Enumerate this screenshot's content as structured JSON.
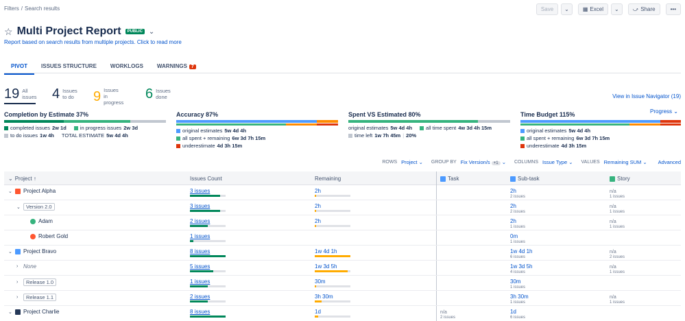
{
  "breadcrumbs": [
    "Filters",
    "Search results"
  ],
  "actions": {
    "save": "Save",
    "excel": "Excel",
    "share": "Share",
    "more": "•••"
  },
  "title": "Multi Project Report",
  "badge": "PUBLIC",
  "subtitle": "Report based on search results from multiple projects. Click to read more",
  "tabs": [
    {
      "label": "PIVOT"
    },
    {
      "label": "ISSUES STRUCTURE"
    },
    {
      "label": "WORKLOGS"
    },
    {
      "label": "WARNINGS",
      "badge": "7"
    }
  ],
  "counters": [
    {
      "num": "19",
      "l1": "All",
      "l2": "issues",
      "color": "#172b4d"
    },
    {
      "num": "4",
      "l1": "Issues",
      "l2": "to do",
      "color": "#172b4d"
    },
    {
      "num": "9",
      "l1": "Issues",
      "l2": "in progress",
      "color": "#ffab00"
    },
    {
      "num": "6",
      "l1": "Issues",
      "l2": "done",
      "color": "#00875a"
    }
  ],
  "view_link": "View in Issue Navigator (19)",
  "progress_dropdown": "Progress",
  "metrics": {
    "completion": {
      "title": "Completion by Estimate",
      "pct": "37%",
      "r1a_label": "completed issues",
      "r1a_val": "2w 1d",
      "r1b_label": "in progress issues",
      "r1b_val": "2w 3d",
      "r2a_label": "to do issues",
      "r2a_val": "1w 4h",
      "r2b_label": "TOTAL ESTIMATE",
      "r2b_val": "5w 4d 4h"
    },
    "accuracy": {
      "title": "Accuracy",
      "pct": "87%",
      "r1_label": "original estimates",
      "r1_val": "5w 4d 4h",
      "r2_label": "all spent + remaining",
      "r2_val": "6w 3d 7h 15m",
      "r3_label": "underestimate",
      "r3_val": "4d 3h 15m"
    },
    "spent": {
      "title": "Spent VS Estimated",
      "pct": "80%",
      "r1a_label": "original estimates",
      "r1a_val": "5w 4d 4h",
      "r1b_label": "all time spent",
      "r1b_val": "4w 3d 4h 15m",
      "r2_label": "time left",
      "r2_val": "1w 7h 45m",
      "r2_pct": "20%"
    },
    "budget": {
      "title": "Time Budget",
      "pct": "115%",
      "r1_label": "original estimates",
      "r1_val": "5w 4d 4h",
      "r2_label": "all spent + remaining",
      "r2_val": "6w 3d 7h 15m",
      "r3_label": "underestimate",
      "r3_val": "4d 3h 15m"
    }
  },
  "pivot": {
    "rows_label": "ROWS",
    "rows_value": "Project",
    "group_label": "GROUP BY",
    "group_value": "Fix Version/s",
    "group_extra": "+1",
    "cols_label": "COLUMNS",
    "cols_value": "Issue Type",
    "values_label": "VALUES",
    "values_value": "Remaining SUM",
    "advanced": "Advanced"
  },
  "table": {
    "headers": {
      "project": "Project ↑",
      "count": "Issues Count",
      "remaining": "Remaining",
      "task": "Task",
      "subtask": "Sub-task",
      "story": "Story"
    },
    "rows": [
      {
        "name": "Project Alpha",
        "count": "3 issues",
        "count_fill": 0.85,
        "rem": "2h",
        "rem_fill": 0.04,
        "rem_color": "#ffab00",
        "task": "",
        "task_sub": "",
        "subtask": "2h",
        "subtask_sub": "2 issues",
        "story": "n/a",
        "story_sub": "1 issues"
      },
      {
        "name": "Version 2.0",
        "count": "3 issues",
        "count_fill": 0.85,
        "rem": "2h",
        "rem_fill": 0.04,
        "rem_color": "#ffab00",
        "task": "",
        "task_sub": "",
        "subtask": "2h",
        "subtask_sub": "2 issues",
        "story": "n/a",
        "story_sub": "1 issues"
      },
      {
        "name": "Adam",
        "count": "2 issues",
        "count_fill": 0.5,
        "rem": "2h",
        "rem_fill": 0.04,
        "rem_color": "#ffab00",
        "task": "",
        "task_sub": "",
        "subtask": "2h",
        "subtask_sub": "1 issues",
        "story": "n/a",
        "story_sub": "1 issues"
      },
      {
        "name": "Robert Gold",
        "count": "1 issues",
        "count_fill": 0.1,
        "rem": "",
        "rem_fill": 0,
        "rem_color": "#ffab00",
        "task": "",
        "task_sub": "",
        "subtask": "0m",
        "subtask_sub": "1 issues",
        "story": "",
        "story_sub": ""
      },
      {
        "name": "Project Bravo",
        "count": "8 issues",
        "count_fill": 1.0,
        "rem": "1w 4d 1h",
        "rem_fill": 1.0,
        "rem_color": "#ffab00",
        "task": "",
        "task_sub": "",
        "subtask": "1w 4d 1h",
        "subtask_sub": "6 issues",
        "story": "n/a",
        "story_sub": "2 issues"
      },
      {
        "name": "None",
        "count": "5 issues",
        "count_fill": 0.65,
        "rem": "1w 3d 5h",
        "rem_fill": 0.93,
        "rem_color": "#ffab00",
        "task": "",
        "task_sub": "",
        "subtask": "1w 3d 5h",
        "subtask_sub": "4 issues",
        "story": "n/a",
        "story_sub": "1 issues"
      },
      {
        "name": "Release 1.0",
        "count": "1 issues",
        "count_fill": 0.5,
        "rem": "30m",
        "rem_fill": 0.04,
        "rem_color": "#ffab00",
        "task": "",
        "task_sub": "",
        "subtask": "30m",
        "subtask_sub": "1 issues",
        "story": "",
        "story_sub": ""
      },
      {
        "name": "Release 1.1",
        "count": "2 issues",
        "count_fill": 0.5,
        "rem": "3h 30m",
        "rem_fill": 0.2,
        "rem_color": "#ffab00",
        "task": "",
        "task_sub": "",
        "subtask": "3h 30m",
        "subtask_sub": "1 issues",
        "story": "n/a",
        "story_sub": "1 issues"
      },
      {
        "name": "Project Charlie",
        "count": "8 issues",
        "count_fill": 1.0,
        "rem": "1d",
        "rem_fill": 0.1,
        "rem_color": "#ffab00",
        "task": "n/a",
        "task_sub": "2 issues",
        "subtask": "1d",
        "subtask_sub": "6 issues",
        "story": "",
        "story_sub": ""
      }
    ]
  },
  "colors": {
    "done": "#00875a",
    "progress": "#36b37e",
    "todo": "#c1c7d0",
    "blue": "#4c9aff",
    "orange": "#ff8b00",
    "red": "#de350b",
    "link": "#0052cc"
  }
}
